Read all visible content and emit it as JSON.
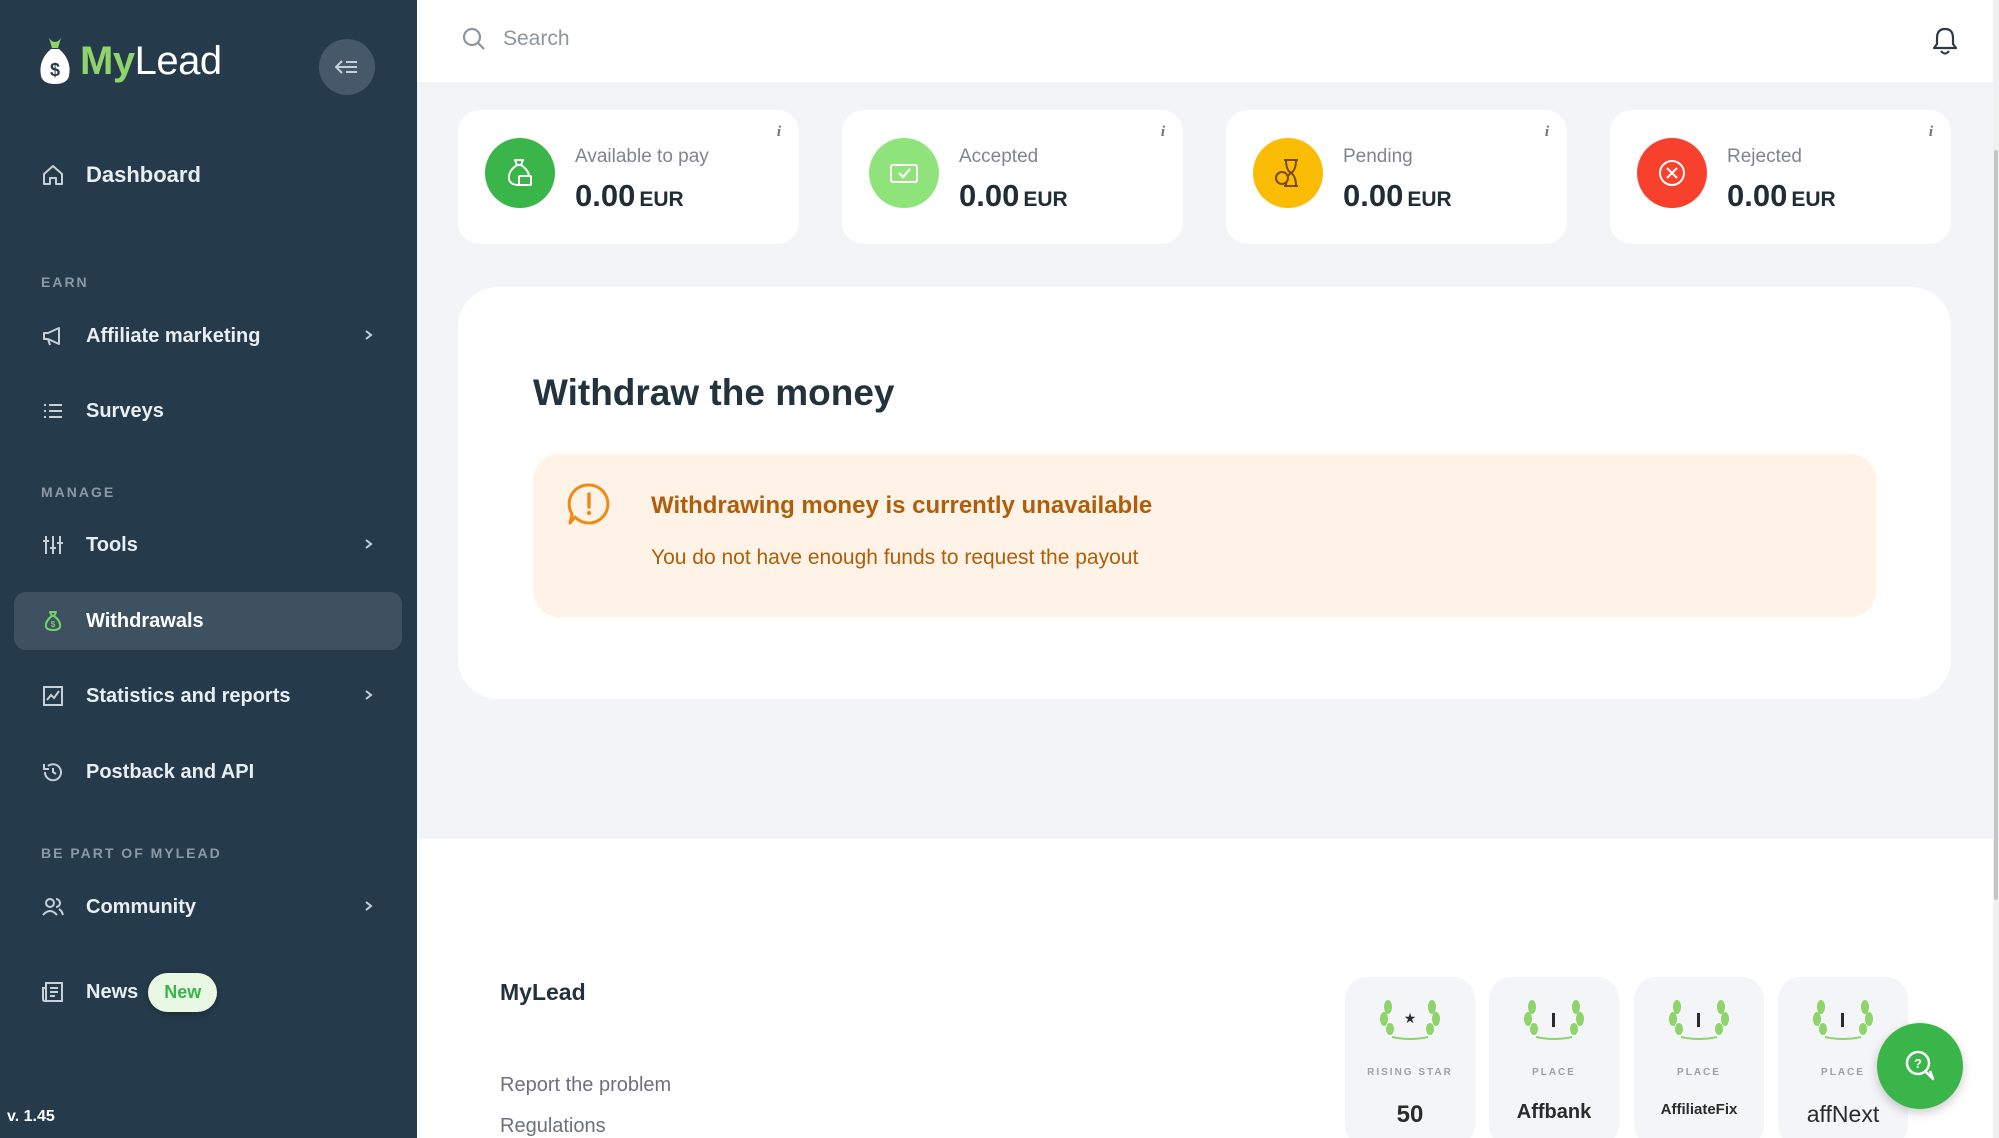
{
  "brand": {
    "my": "My",
    "lead": "Lead"
  },
  "sidebar": {
    "dashboard": "Dashboard",
    "sections": {
      "earn": "EARN",
      "manage": "MANAGE",
      "be_part": "BE PART OF MYLEAD"
    },
    "items": {
      "affiliate": "Affiliate marketing",
      "surveys": "Surveys",
      "tools": "Tools",
      "withdrawals": "Withdrawals",
      "statistics": "Statistics and reports",
      "postback": "Postback and API",
      "community": "Community",
      "news": "News"
    },
    "news_badge": "New",
    "version": "v. 1.45"
  },
  "search": {
    "placeholder": "Search"
  },
  "stats": [
    {
      "label": "Available to pay",
      "value": "0.00",
      "currency": "EUR",
      "color": "#3ab54a",
      "icon": "money-bag-icon"
    },
    {
      "label": "Accepted",
      "value": "0.00",
      "currency": "EUR",
      "color": "#8fe37b",
      "icon": "cash-check-icon"
    },
    {
      "label": "Pending",
      "value": "0.00",
      "currency": "EUR",
      "color": "#fbbc05",
      "icon": "hourglass-coin-icon"
    },
    {
      "label": "Rejected",
      "value": "0.00",
      "currency": "EUR",
      "color": "#f8412d",
      "icon": "circle-x-icon"
    }
  ],
  "info_symbol": "i",
  "withdraw": {
    "title": "Withdraw the money",
    "alert_title": "Withdrawing money is currently unavailable",
    "alert_text": "You do not have enough funds to request the payout"
  },
  "footer": {
    "title": "MyLead",
    "links": [
      "Report the problem",
      "Regulations"
    ],
    "awards": [
      {
        "tag": "RISING STAR",
        "brand": "50"
      },
      {
        "tag": "PLACE",
        "brand": "Affbank"
      },
      {
        "tag": "PLACE",
        "brand": "AffiliateFix"
      },
      {
        "tag": "PLACE",
        "brand": "affNext"
      }
    ]
  }
}
